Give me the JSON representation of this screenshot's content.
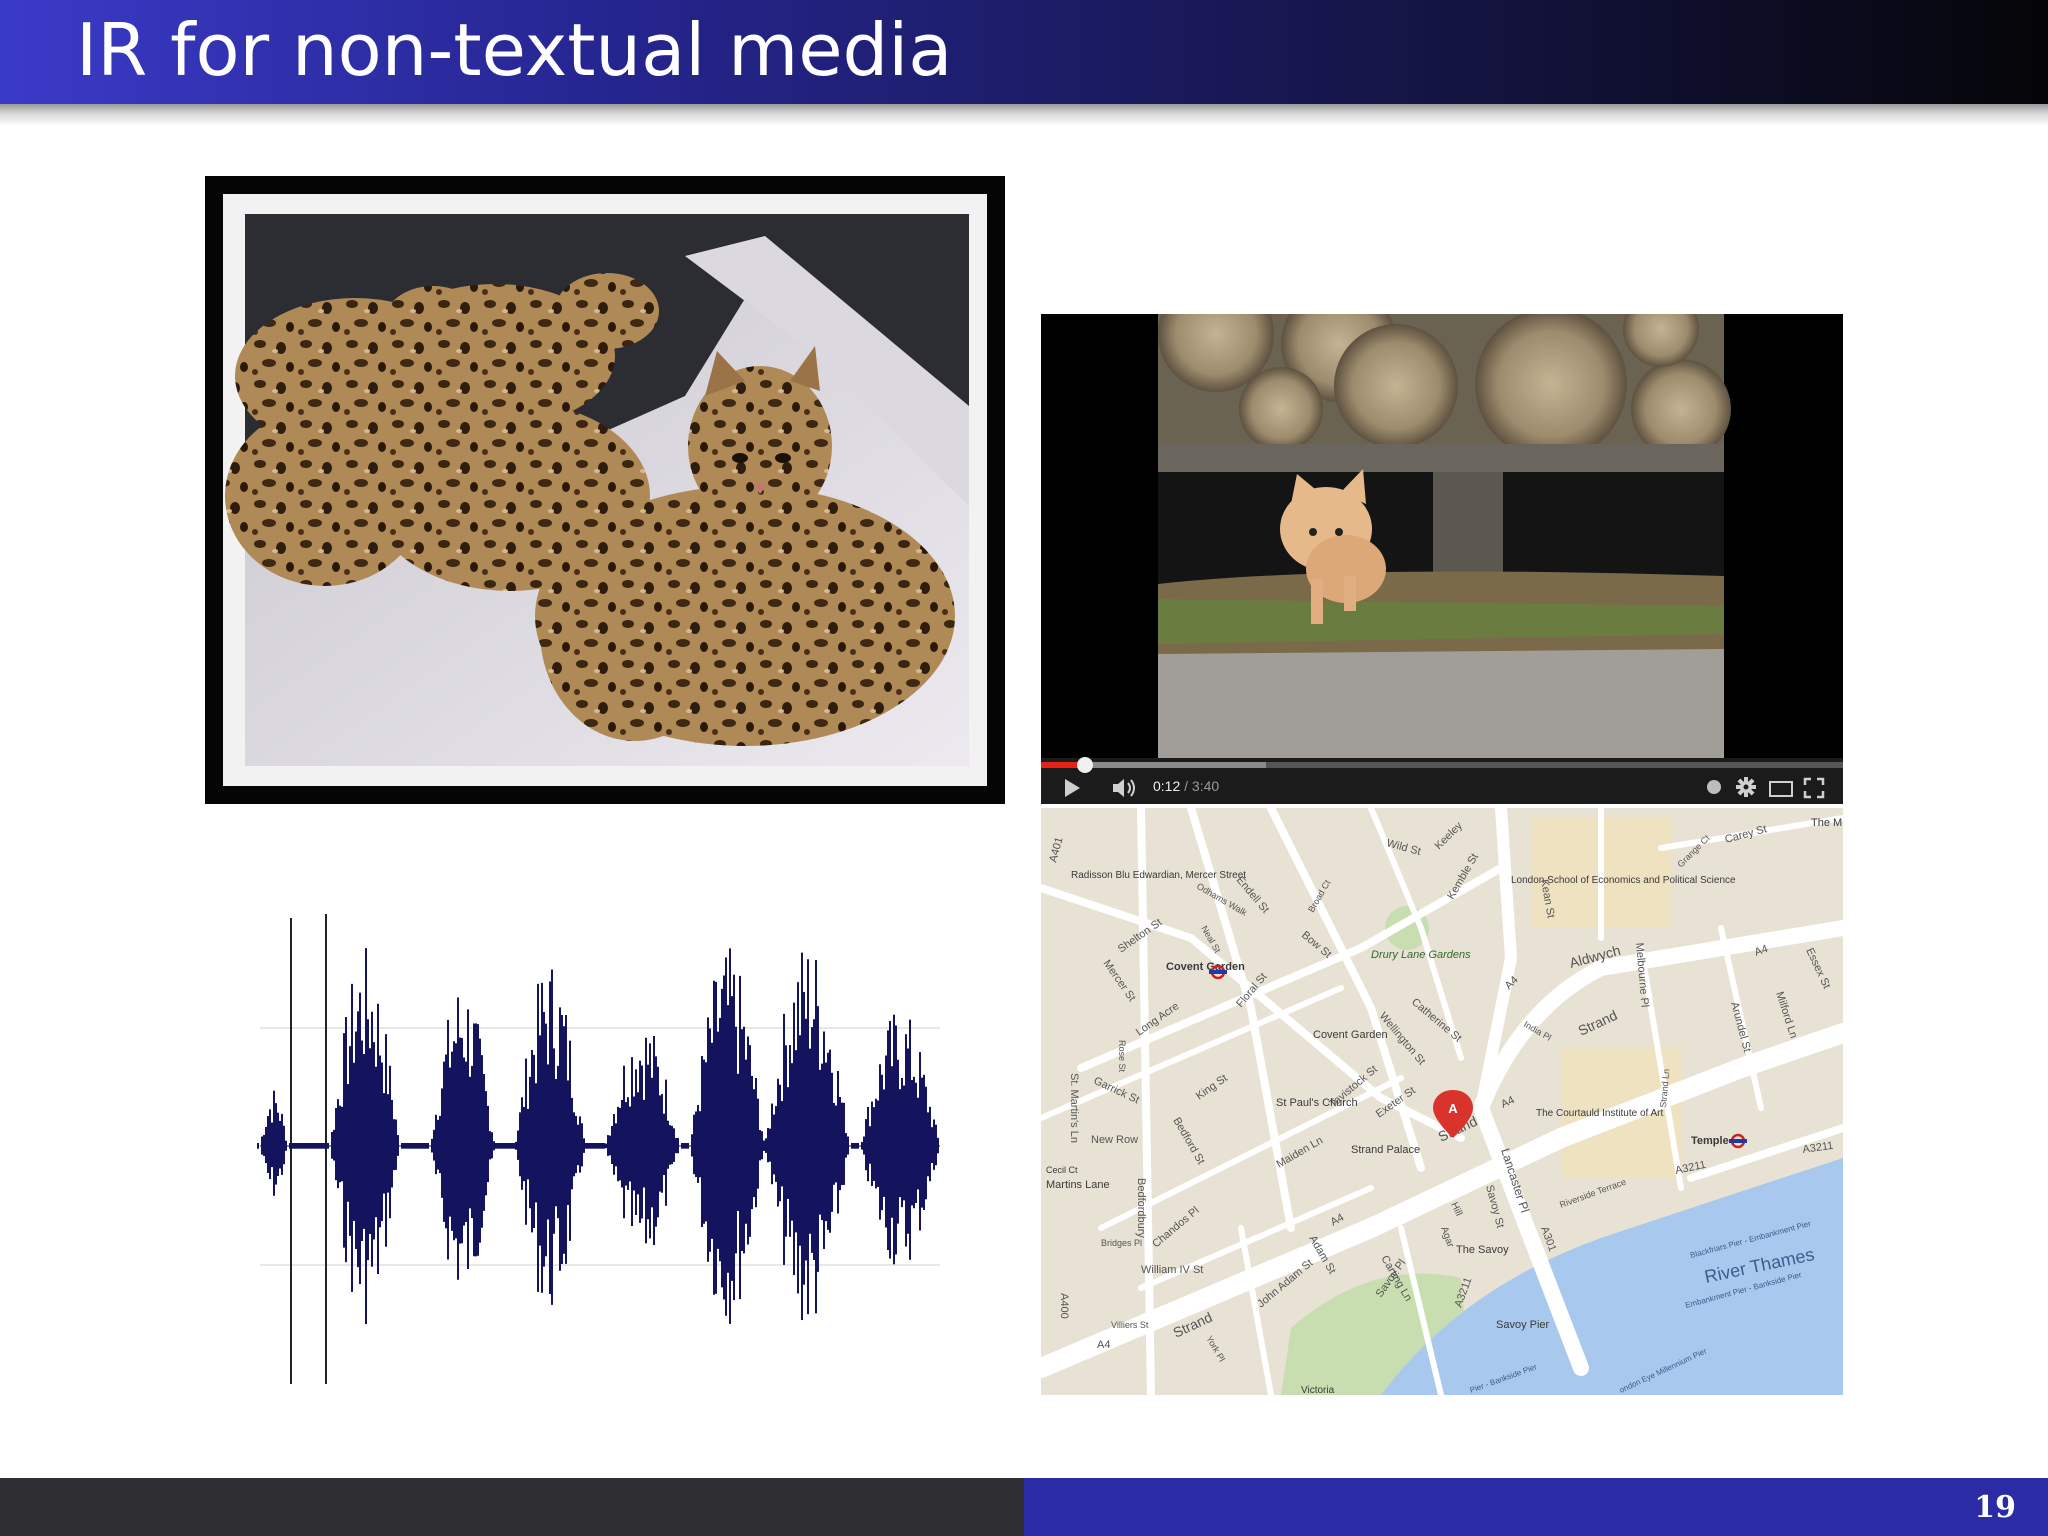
{
  "slide": {
    "title": "IR for non-textual media",
    "page_number": "19"
  },
  "image_panel": {
    "subject": "bengal-kittens-photo"
  },
  "video_player": {
    "subject": "kitten-under-logs-video",
    "time_current": "0:12",
    "time_separator": " / ",
    "time_total": "3:40",
    "progress_fraction": 0.055,
    "buffered_fraction": 0.28,
    "progress_color": "#e62117",
    "icons": [
      "play-icon",
      "volume-icon",
      "watch-later-icon",
      "settings-gear-icon",
      "theater-mode-icon",
      "fullscreen-icon"
    ]
  },
  "audio_waveform": {
    "subject": "speech-waveform",
    "color": "#14145e"
  },
  "map": {
    "marker_letter": "A",
    "marker_color": "#d9342b",
    "river_label": "River Thames",
    "streets": [
      "Strand",
      "Strand",
      "Strand",
      "Aldwych",
      "A4",
      "A4",
      "A4",
      "A4",
      "A4",
      "A3211",
      "A3211",
      "A3211",
      "A301",
      "A400",
      "A401",
      "Wild St",
      "Keeley",
      "Carey St",
      "Kean St",
      "Kemble St",
      "Bow St",
      "Endell St",
      "Shelton St",
      "Mercer St",
      "Long Acre",
      "Floral St",
      "King St",
      "Garrick St",
      "New Row",
      "Bedford St",
      "Maiden Ln",
      "Tavistock St",
      "Exeter St",
      "Wellington St",
      "Catherine St",
      "Savoy St",
      "Lancaster Pl",
      "Arundel St",
      "Milford Ln",
      "Essex St",
      "Melbourne Pl",
      "Chandos Pl",
      "William IV St",
      "Adam St",
      "John Adam St",
      "Carting Ln",
      "Savoy Pl",
      "St. Martin's Ln",
      "Bedfordbury",
      "Bridges Pl",
      "Rose St",
      "Broad Ct",
      "Neal St",
      "Odhams Walk",
      "Grange Ct",
      "Riverside Terrace",
      "Strand Ln",
      "Hill",
      "Agar",
      "Villiers St",
      "York Pl",
      "India Pl"
    ],
    "places": [
      "Radisson Blu Edwardian, Mercer Street",
      "Covent Garden",
      "Covent Garden",
      "St Paul's Church",
      "Drury Lane Gardens",
      "London School of Economics and Political Science",
      "The Courtauld Institute of Art",
      "Strand Palace",
      "The Savoy",
      "Savoy Pier",
      "Temple",
      "Cecil Ct",
      "Martins Lane",
      "The M",
      "Victoria"
    ],
    "piers": [
      "Blackfriars Pier - Embankment Pier",
      "Embankment Pier - Bankside Pier",
      "Pier - Bankside Pier",
      "ondon Eye Millennium Pier"
    ],
    "colors": {
      "land": "#e8e2d4",
      "roads": "#ffffff",
      "water": "#a8c8ee",
      "park": "#c8deb0",
      "campus": "#eee2c0"
    }
  }
}
